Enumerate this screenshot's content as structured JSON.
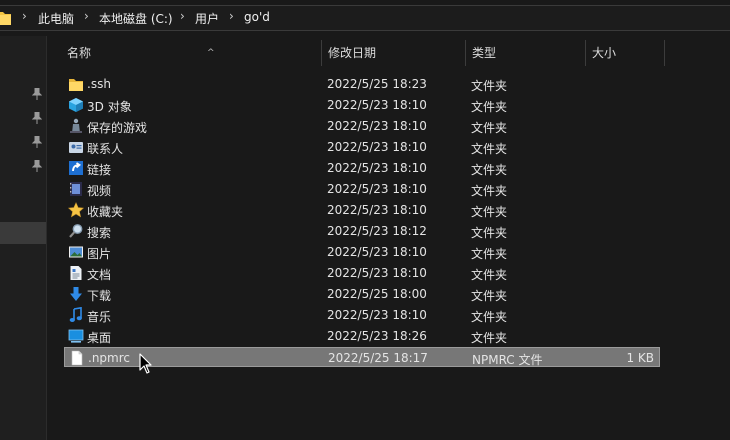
{
  "breadcrumb": {
    "items": [
      "此电脑",
      "本地磁盘 (C:)",
      "用户",
      "go'd"
    ],
    "separator": "›"
  },
  "columns": {
    "name": "名称",
    "modified": "修改日期",
    "type": "类型",
    "size": "大小"
  },
  "files": [
    {
      "name": ".ssh",
      "modified": "2022/5/25 18:23",
      "type": "文件夹",
      "size": "",
      "icon": "folder-icon"
    },
    {
      "name": "3D 对象",
      "modified": "2022/5/23 18:10",
      "type": "文件夹",
      "size": "",
      "icon": "3d-objects-icon"
    },
    {
      "name": "保存的游戏",
      "modified": "2022/5/23 18:10",
      "type": "文件夹",
      "size": "",
      "icon": "saved-games-icon"
    },
    {
      "name": "联系人",
      "modified": "2022/5/23 18:10",
      "type": "文件夹",
      "size": "",
      "icon": "contacts-icon"
    },
    {
      "name": "链接",
      "modified": "2022/5/23 18:10",
      "type": "文件夹",
      "size": "",
      "icon": "links-icon"
    },
    {
      "name": "视频",
      "modified": "2022/5/23 18:10",
      "type": "文件夹",
      "size": "",
      "icon": "videos-icon"
    },
    {
      "name": "收藏夹",
      "modified": "2022/5/23 18:10",
      "type": "文件夹",
      "size": "",
      "icon": "favorites-icon"
    },
    {
      "name": "搜索",
      "modified": "2022/5/23 18:12",
      "type": "文件夹",
      "size": "",
      "icon": "search-icon"
    },
    {
      "name": "图片",
      "modified": "2022/5/23 18:10",
      "type": "文件夹",
      "size": "",
      "icon": "pictures-icon"
    },
    {
      "name": "文档",
      "modified": "2022/5/23 18:10",
      "type": "文件夹",
      "size": "",
      "icon": "documents-icon"
    },
    {
      "name": "下载",
      "modified": "2022/5/25 18:00",
      "type": "文件夹",
      "size": "",
      "icon": "downloads-icon"
    },
    {
      "name": "音乐",
      "modified": "2022/5/23 18:10",
      "type": "文件夹",
      "size": "",
      "icon": "music-icon"
    },
    {
      "name": "桌面",
      "modified": "2022/5/23 18:26",
      "type": "文件夹",
      "size": "",
      "icon": "desktop-icon"
    },
    {
      "name": ".npmrc",
      "modified": "2022/5/25 18:17",
      "type": "NPMRC 文件",
      "size": "1 KB",
      "icon": "file-icon",
      "selected": true
    }
  ],
  "colors": {
    "background": "#191919",
    "selection": "#777777",
    "folder": "#f4c542"
  }
}
